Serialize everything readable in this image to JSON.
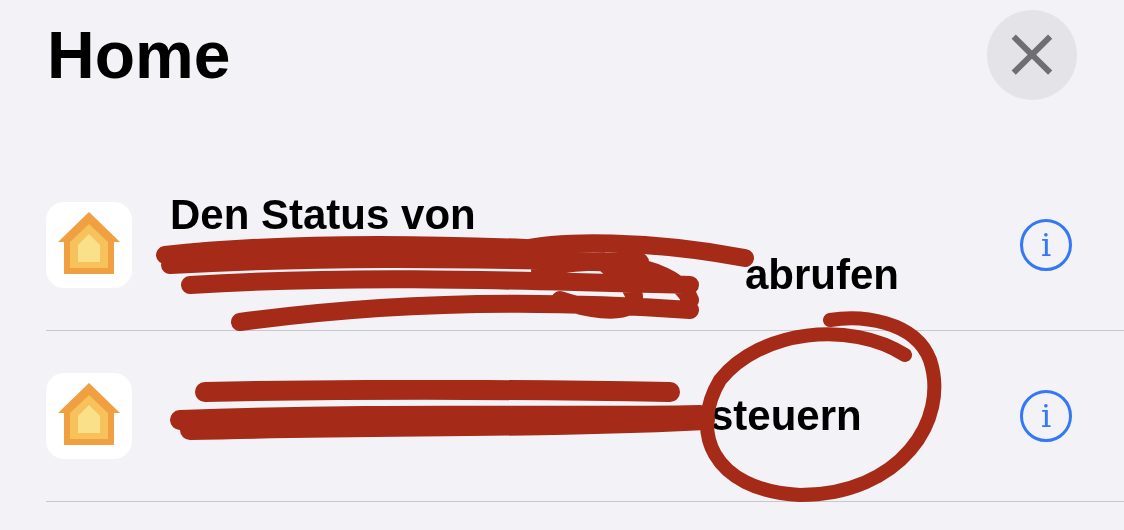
{
  "title": "Home",
  "close": {
    "symbol": "×"
  },
  "shortcuts": [
    {
      "line_1": "Den Status von",
      "line_2": "abrufen",
      "info": "i"
    },
    {
      "line_2": "steuern",
      "info": "i"
    }
  ]
}
